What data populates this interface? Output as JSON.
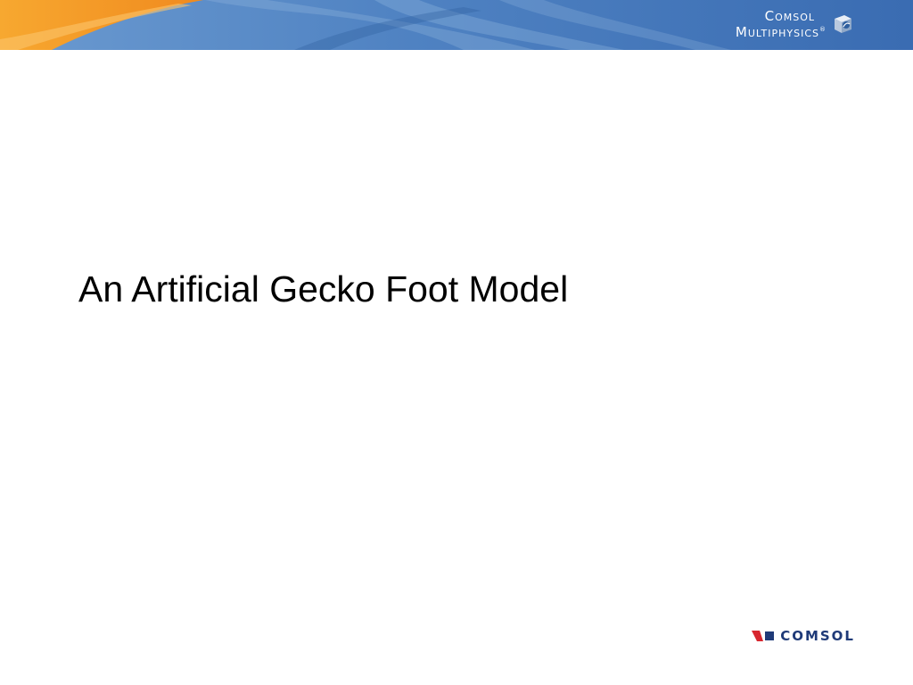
{
  "slide": {
    "title": "An Artificial Gecko Foot Model"
  },
  "header": {
    "logo_line1": "Comsol",
    "logo_line2": "Multiphysics",
    "registered_mark": "®",
    "logo_icon": "cube-icon"
  },
  "footer": {
    "logo_text": "COMSOL",
    "logo_icon": "comsol-mark-icon"
  },
  "colors": {
    "banner_blue": "#3d6fb4",
    "banner_orange": "#f39a2a",
    "logo_red": "#d7262e",
    "logo_navy": "#1f3a78"
  }
}
